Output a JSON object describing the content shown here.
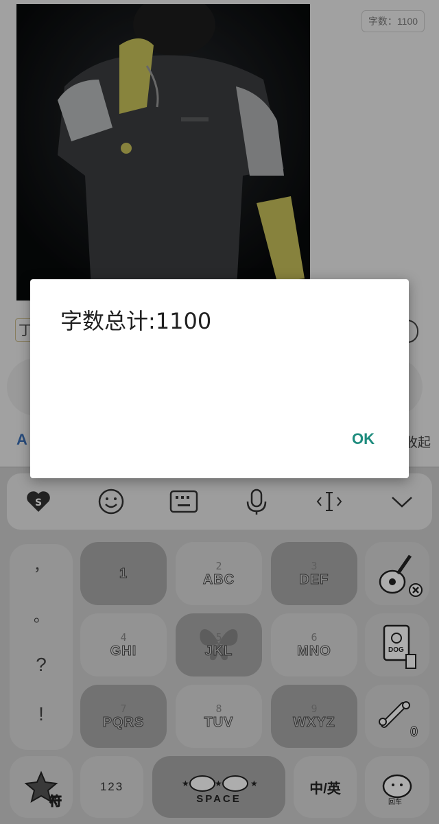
{
  "editor": {
    "char_count_badge": "字数：1100",
    "text_fragment": "丁",
    "collapse_label": "收起",
    "format_label": "A"
  },
  "dialog": {
    "message": "字数总计:1100",
    "ok_label": "OK"
  },
  "keyboard": {
    "toolbar_icons": [
      "sogou-heart-logo-icon",
      "emoji-icon",
      "keyboard-icon",
      "microphone-icon",
      "cursor-move-icon",
      "chevron-down-icon"
    ],
    "punctuation": [
      "，",
      "。",
      "?",
      "!"
    ],
    "keys": [
      {
        "num": "",
        "letters": "1"
      },
      {
        "num": "2",
        "letters": "ABC"
      },
      {
        "num": "3",
        "letters": "DEF"
      },
      {
        "num": "4",
        "letters": "GHI"
      },
      {
        "num": "5",
        "letters": "JKL"
      },
      {
        "num": "6",
        "letters": "MNO"
      },
      {
        "num": "7",
        "letters": "PQRS"
      },
      {
        "num": "8",
        "letters": "TUV"
      },
      {
        "num": "9",
        "letters": "WXYZ"
      }
    ],
    "side_keys": {
      "dog_sign": "DOG",
      "zero": "0"
    },
    "bottom": {
      "symbols_label": "符",
      "numbers_label": "123",
      "space_label": "SPACE",
      "lang_label": "中/英",
      "enter_label": "回车"
    }
  }
}
